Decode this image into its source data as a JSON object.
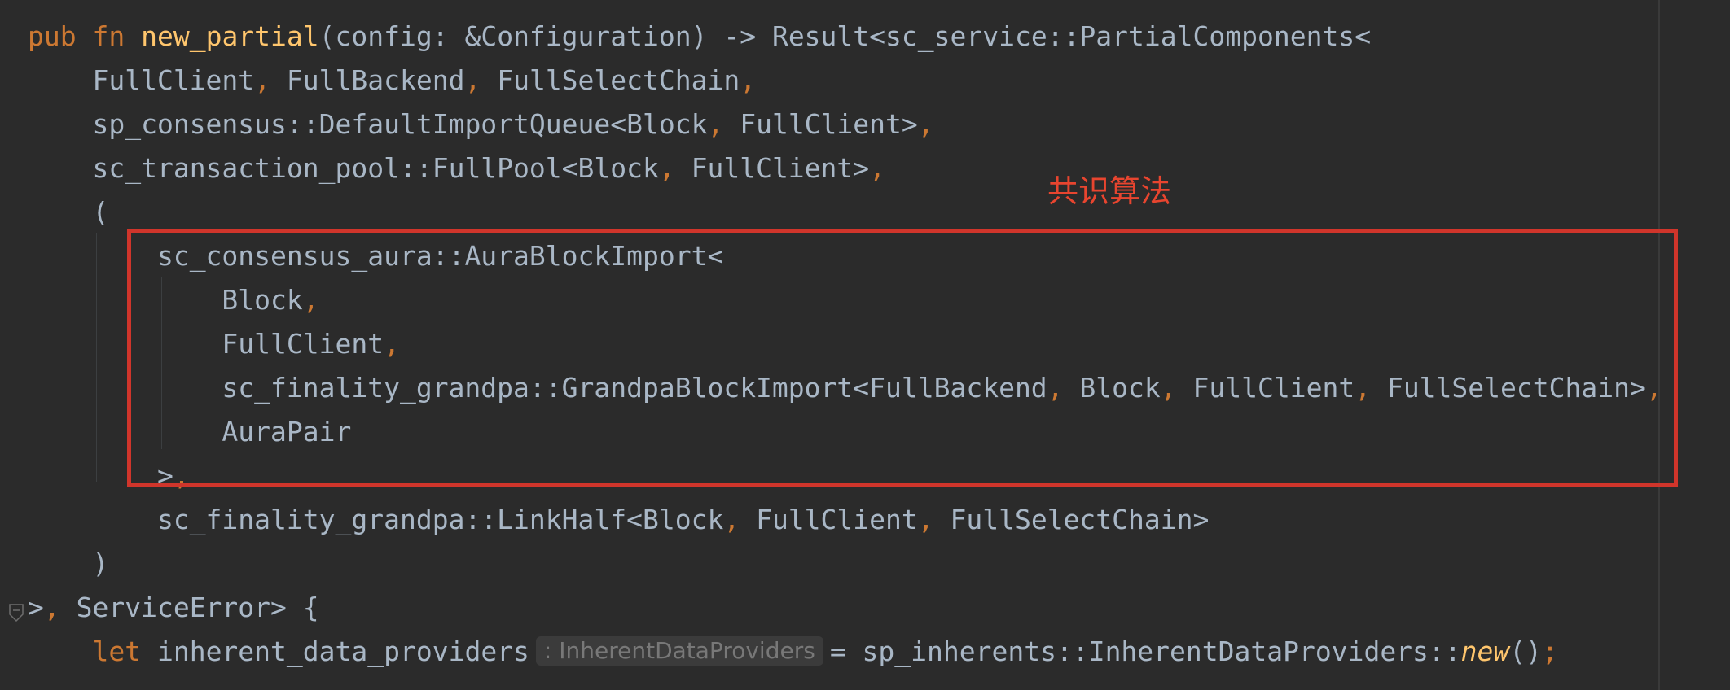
{
  "editor": {
    "code": {
      "l1": {
        "t1": "pub",
        "t2": "fn",
        "t3": "new_partial",
        "t4": "(config: &Configuration) -> Result<sc_service::PartialComponents<"
      },
      "l2": {
        "t1": "FullClient",
        "t2": ",",
        "t3": " FullBackend",
        "t4": ",",
        "t5": " FullSelectChain",
        "t6": ","
      },
      "l3": {
        "t1": "sp_consensus::DefaultImportQueue<Block",
        "t2": ",",
        "t3": " FullClient>",
        "t4": ","
      },
      "l4": {
        "t1": "sc_transaction_pool::FullPool<Block",
        "t2": ",",
        "t3": " FullClient>",
        "t4": ","
      },
      "l5": {
        "t1": "("
      },
      "l6": {
        "t1": "sc_consensus_aura::AuraBlockImport<"
      },
      "l7": {
        "t1": "Block",
        "t2": ","
      },
      "l8": {
        "t1": "FullClient",
        "t2": ","
      },
      "l9": {
        "t1": "sc_finality_grandpa::GrandpaBlockImport<FullBackend",
        "t2": ",",
        "t3": " Block",
        "t4": ",",
        "t5": " FullClient",
        "t6": ",",
        "t7": " FullSelectChain>",
        "t8": ","
      },
      "l10": {
        "t1": "AuraPair"
      },
      "l11": {
        "t1": ">",
        "t2": ","
      },
      "l12": {
        "t1": "sc_finality_grandpa::LinkHalf<Block",
        "t2": ",",
        "t3": " FullClient",
        "t4": ",",
        "t5": " FullSelectChain>"
      },
      "l13": {
        "t1": ")"
      },
      "l14": {
        "t1": ">",
        "t2": ",",
        "t3": " ServiceError> {"
      },
      "l15": {
        "t1": "let",
        "t2": " inherent_data_providers",
        "hint": ": InherentDataProviders",
        "t3": "= sp_inherents::InherentDataProviders::",
        "t4": "new",
        "t5": "()",
        "t6": ";"
      }
    },
    "inlay_hint": ": InherentDataProviders"
  },
  "annotation": {
    "label": "共识算法",
    "color": "#e8452f"
  },
  "colors": {
    "background": "#2b2b2b",
    "text": "#a9b7c6",
    "keyword": "#cc7832",
    "function": "#ffc66d",
    "highlight_box": "#d0352b"
  }
}
